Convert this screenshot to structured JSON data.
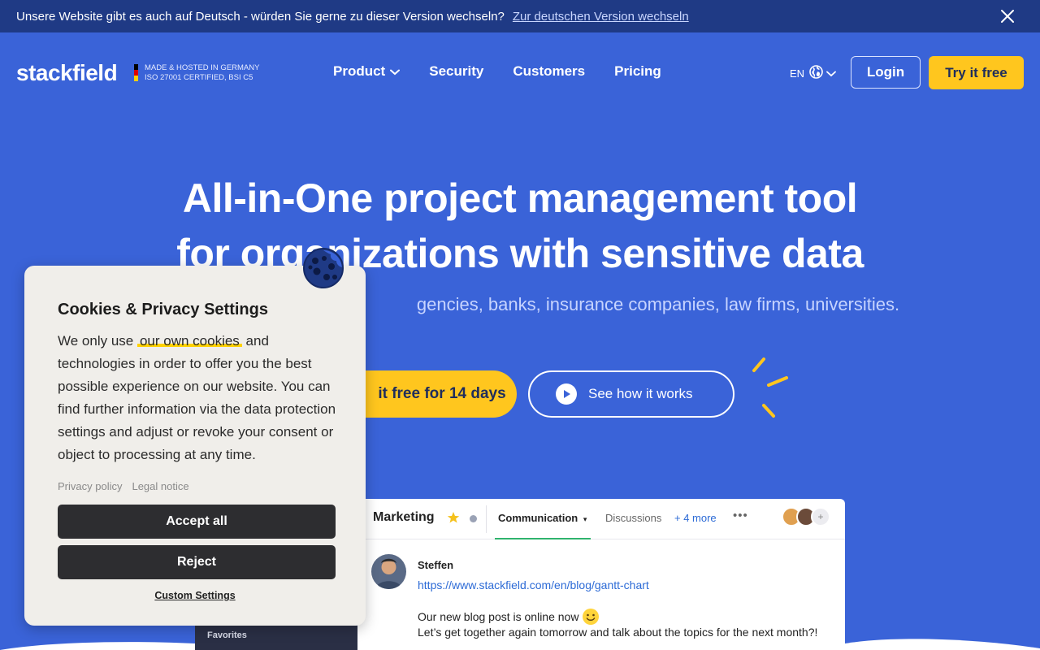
{
  "langbar": {
    "message": "Unsere Website gibt es auch auf Deutsch - würden Sie gerne zu dieser Version wechseln?",
    "switch_link": "Zur deutschen Version wechseln"
  },
  "header": {
    "logo": "stackfield",
    "badge_line1": "MADE & HOSTED IN GERMANY",
    "badge_line2": "ISO 27001 CERTIFIED, BSI C5",
    "nav": [
      {
        "label": "Product"
      },
      {
        "label": "Security"
      },
      {
        "label": "Customers"
      },
      {
        "label": "Pricing"
      }
    ],
    "language": "EN",
    "login": "Login",
    "try_free": "Try it free"
  },
  "hero": {
    "title_line1": "All-in-One project management tool",
    "title_line2": "for organizations with sensitive data",
    "subtitle": "gencies, banks, insurance companies, law firms, universities.",
    "cta_primary": "it free for 14 days",
    "cta_secondary": "See how it works"
  },
  "app_preview": {
    "room_title": "Marketing",
    "active_tab": "Communication",
    "tab_discussions": "Discussions",
    "more_tabs": "+ 4 more",
    "sidebar_favorites": "Favorites",
    "author": "Steffen",
    "link": "https://www.stackfield.com/en/blog/gantt-chart",
    "message1": "Our new blog post is online now",
    "message2": "Let’s get together again tomorrow and talk about the topics for the next month?!"
  },
  "cookie": {
    "title": "Cookies & Privacy Settings",
    "body_before": "We only use",
    "body_highlight": "our own cookies",
    "body_after": "and technologies in order to offer you the best possible experience on our website. You can find further information via the data protection settings and adjust or revoke your consent or object to processing at any time.",
    "privacy_policy": "Privacy policy",
    "legal_notice": "Legal notice",
    "accept_all": "Accept all",
    "reject": "Reject",
    "custom_settings": "Custom Settings"
  },
  "colors": {
    "brand_blue": "#3a63d8",
    "topbar_blue": "#1f3a85",
    "accent_yellow": "#ffc61e",
    "dark_button": "#2d2d30",
    "link_blue": "#2d6bd6",
    "active_tab_green": "#2fb36d"
  },
  "icons": {
    "close": "close-icon",
    "chevron": "chevron-down-icon",
    "globe": "globe-icon",
    "play": "play-icon",
    "star": "star-icon",
    "cookie": "cookie-icon"
  }
}
